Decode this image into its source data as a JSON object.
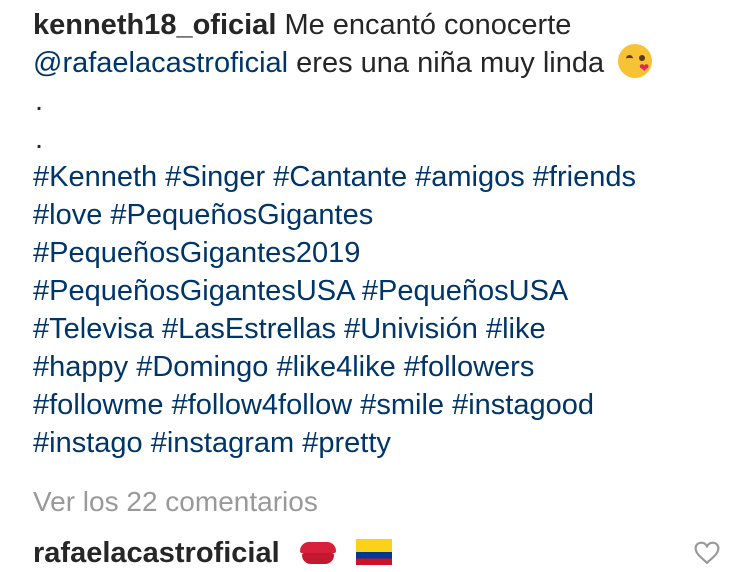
{
  "post": {
    "author": "kenneth18_oficial",
    "caption_start": "Me encantó conocerte",
    "mention": "@rafaelacastroficial",
    "caption_middle": "eres una niña muy linda",
    "caption_emoji": "face-blowing-a-kiss",
    "dots": [
      ".",
      "."
    ],
    "hashtag_lines": [
      "#Kenneth #Singer #Cantante #amigos #friends",
      "#love #PequeñosGigantes",
      "#PequeñosGigantes2019",
      "#PequeñosGigantesUSA #PequeñosUSA",
      "#Televisa #LasEstrellas #Univisión #like",
      "#happy #Domingo #like4like #followers",
      "#followme #follow4follow #smile #instagood",
      "#instago #instagram #pretty"
    ]
  },
  "comments_link": "Ver los 22 comentarios",
  "comment": {
    "user": "rafaelacastroficial",
    "emojis": [
      "kiss-mark",
      "flag-colombia"
    ]
  },
  "colors": {
    "text": "#262626",
    "link": "#003569",
    "muted": "#999999"
  },
  "icons": {
    "like": "heart-outline-icon"
  }
}
